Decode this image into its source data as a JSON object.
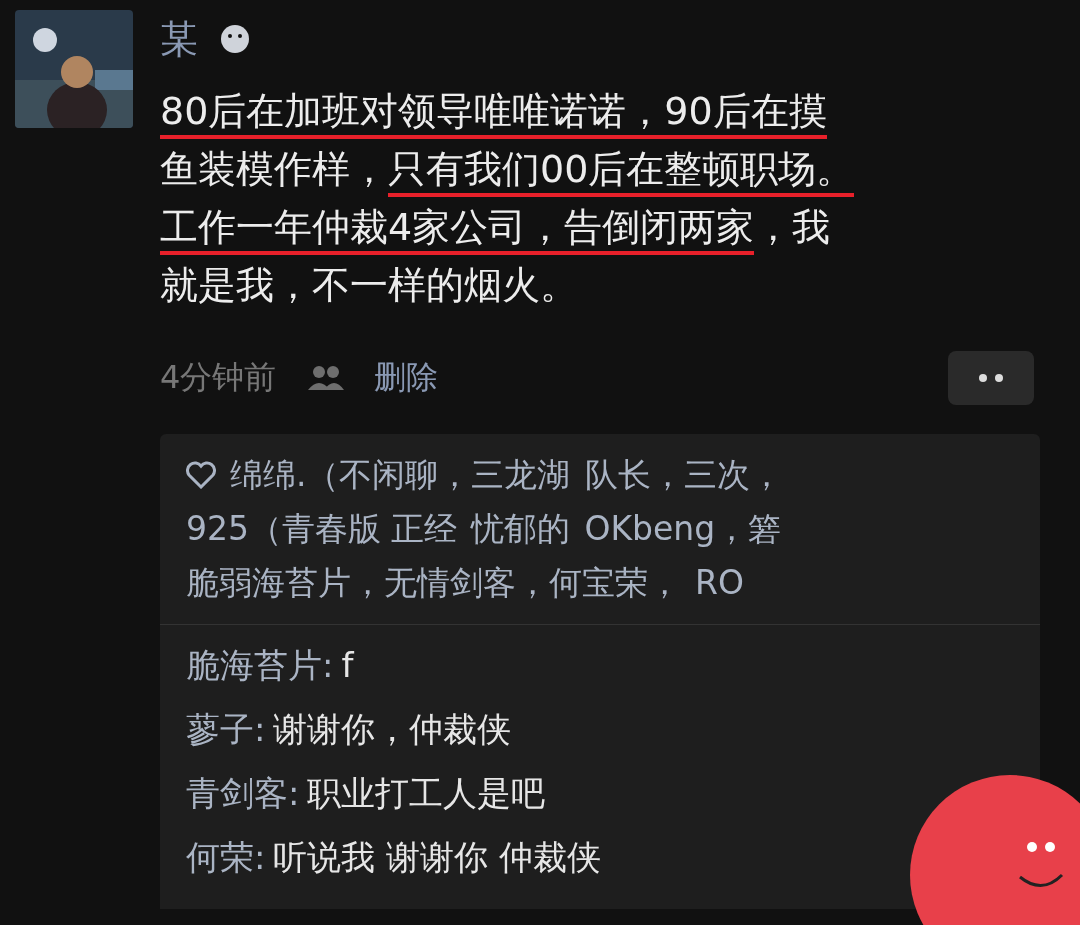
{
  "post": {
    "author": "某",
    "lines": [
      [
        {
          "text": "80后在加班对领导唯唯诺诺，90后在摸",
          "underlined": true
        }
      ],
      [
        {
          "text": "鱼装模作样，",
          "underlined": false
        },
        {
          "text": "只有我们00后在整顿职场。",
          "underlined": true
        }
      ],
      [
        {
          "text": "工作一年仲裁4家公司，告倒闭两家",
          "underlined": true
        },
        {
          "text": "，我",
          "underlined": false
        }
      ],
      [
        {
          "text": "就是我，不一样的烟火。",
          "underlined": false
        }
      ]
    ],
    "time": "4分钟前",
    "delete": "删除"
  },
  "likes": [
    "绵绵.（不闲聊，三龙湖",
    "队长，三次，",
    "925（青春版 正经",
    "忧郁的",
    "OKbeng，箬",
    "脆弱海苔片，无情剑客，何宝荣，",
    "RO"
  ],
  "comments": [
    {
      "name": "脆海苔片:",
      "text": "f"
    },
    {
      "name": "蓼子:",
      "text": "谢谢你，仲裁侠"
    },
    {
      "name": "青剑客:",
      "text": "职业打工人是吧"
    },
    {
      "name": "何荣:",
      "text": "听说我 谢谢你 仲裁侠"
    }
  ]
}
